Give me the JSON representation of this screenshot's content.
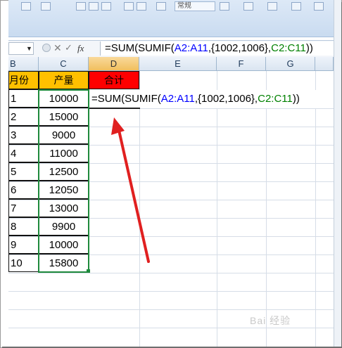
{
  "formula_bar": {
    "fx_label": "fx",
    "formula_prefix": "=SUM(SUMIF(",
    "formula_ref1": "A2:A11",
    "formula_mid": ",{1002,1006},",
    "formula_ref2": "C2:C11",
    "formula_suffix": "))"
  },
  "ribbon": {
    "font_name": "常规"
  },
  "columns": [
    "B",
    "C",
    "D",
    "E",
    "F",
    "G"
  ],
  "headers": {
    "b": "月份",
    "c": "产量",
    "d": "合计"
  },
  "rows": [
    {
      "b": "1",
      "c": "10000"
    },
    {
      "b": "2",
      "c": "15000"
    },
    {
      "b": "3",
      "c": "9000"
    },
    {
      "b": "4",
      "c": "11000"
    },
    {
      "b": "5",
      "c": "12500"
    },
    {
      "b": "6",
      "c": "12050"
    },
    {
      "b": "7",
      "c": "13000"
    },
    {
      "b": "8",
      "c": "9900"
    },
    {
      "b": "9",
      "c": "10000"
    },
    {
      "b": "10",
      "c": "15800"
    }
  ],
  "edit_cell": {
    "prefix": "=SUM(SUMIF(",
    "ref1": "A2:A11",
    "mid": ",{1002,1006},",
    "ref2": "C2:C11",
    "suffix": "))"
  },
  "watermark": "Bai 经验",
  "colors": {
    "header_fill": "#ffc000",
    "total_fill": "#ff0000",
    "ref1": "#0000ff",
    "ref2": "#008000",
    "arrow": "#e02020"
  }
}
